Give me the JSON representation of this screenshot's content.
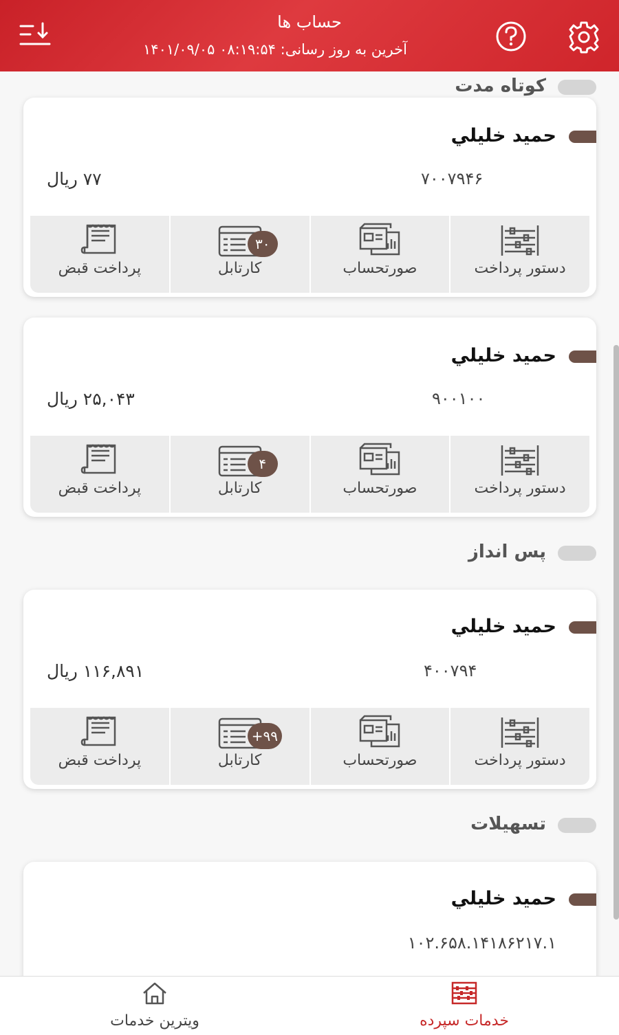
{
  "header": {
    "title": "حساب ها",
    "last_update": "آخرین به روز رسانی: ۰۸:۱۹:۵۴ ۱۴۰۱/۰۹/۰۵",
    "sort_icon": "sort-down-icon",
    "help_icon": "help-icon",
    "settings_icon": "gear-icon",
    "brand_color": "#d42a30"
  },
  "sections": {
    "short_term": "کوتاه مدت",
    "savings": "پس انداز",
    "facilities": "تسهیلات"
  },
  "actions": {
    "payment_order": "دستور پرداخت",
    "statement": "صورتحساب",
    "cartable": "کارتابل",
    "bill_payment": "پرداخت قبض"
  },
  "cards": [
    {
      "name": "حميد خليلي",
      "account": "۷۰۰۷۹۴۶",
      "balance": "۷۷ ریال",
      "badge": "۳۰"
    },
    {
      "name": "حميد خليلي",
      "account": "۹۰۰۱۰۰",
      "balance": "۲۵,۰۴۳ ریال",
      "badge": "۴"
    },
    {
      "name": "حميد خليلي",
      "account": "۴۰۰۷۹۴",
      "balance": "۱۱۶,۸۹۱ ریال",
      "badge": "+۹۹"
    },
    {
      "name": "حميد خليلي",
      "account": "۱۰۲.۶۵۸.۱۴۱۸۶۲۱۷.۱"
    }
  ],
  "bottom_nav": {
    "showcase": "ویترین خدمات",
    "deposit_services": "خدمات سپرده",
    "active_color": "#c62828"
  }
}
